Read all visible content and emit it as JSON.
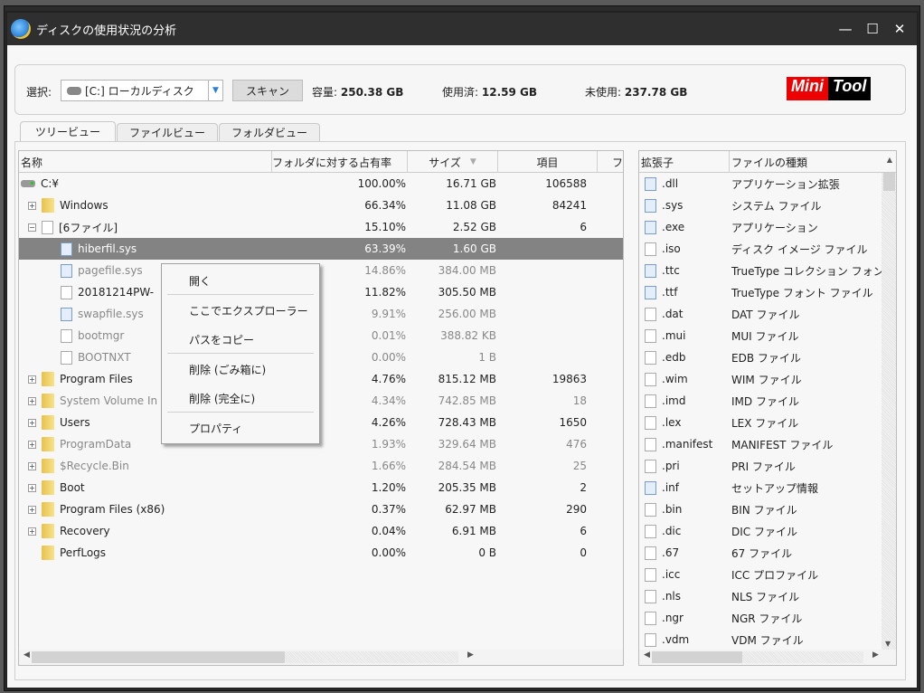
{
  "window": {
    "title": "ディスクの使用状況の分析",
    "minimize": "—",
    "maximize": "☐",
    "close": "✕"
  },
  "toolbar": {
    "select_label": "選択:",
    "drive_value": "[C:] ローカルディスク",
    "scan_label": "スキャン",
    "capacity_label": "容量:",
    "capacity_value": "250.38 GB",
    "used_label": "使用済:",
    "used_value": "12.59 GB",
    "free_label": "未使用:",
    "free_value": "237.78 GB",
    "logo_mini": "Mini",
    "logo_tool": "Tool"
  },
  "tabs": [
    {
      "label": "ツリービュー",
      "active": true
    },
    {
      "label": "ファイルビュー"
    },
    {
      "label": "フォルダビュー"
    }
  ],
  "tree": {
    "headers": {
      "name": "名称",
      "percent": "フォルダに対する占有率",
      "size": "サイズ",
      "items": "項目",
      "more": "フ"
    },
    "rows": [
      {
        "name": "C:¥",
        "percent": "100.00%",
        "size": "16.71 GB",
        "items": "106588",
        "icon": "drive",
        "level": 0,
        "exp": ""
      },
      {
        "name": "Windows",
        "percent": "66.34%",
        "size": "11.08 GB",
        "items": "84241",
        "icon": "folder",
        "level": 1,
        "exp": "+"
      },
      {
        "name": "[6ファイル]",
        "percent": "15.10%",
        "size": "2.52 GB",
        "items": "6",
        "icon": "file",
        "level": 1,
        "exp": "−"
      },
      {
        "name": "hiberfil.sys",
        "percent": "63.39%",
        "size": "1.60 GB",
        "items": "",
        "icon": "sys",
        "level": 2,
        "exp": "",
        "selected": true
      },
      {
        "name": "pagefile.sys",
        "percent": "14.86%",
        "size": "384.00 MB",
        "items": "",
        "icon": "sys",
        "level": 2,
        "exp": "",
        "gray": true
      },
      {
        "name": "20181214PW-",
        "percent": "11.82%",
        "size": "305.50 MB",
        "items": "",
        "icon": "iso",
        "level": 2,
        "exp": ""
      },
      {
        "name": "swapfile.sys",
        "percent": "9.91%",
        "size": "256.00 MB",
        "items": "",
        "icon": "sys",
        "level": 2,
        "exp": "",
        "gray": true
      },
      {
        "name": "bootmgr",
        "percent": "0.01%",
        "size": "388.82 KB",
        "items": "",
        "icon": "file",
        "level": 2,
        "exp": "",
        "gray": true
      },
      {
        "name": "BOOTNXT",
        "percent": "0.00%",
        "size": "1 B",
        "items": "",
        "icon": "file",
        "level": 2,
        "exp": "",
        "gray": true
      },
      {
        "name": "Program Files",
        "percent": "4.76%",
        "size": "815.12 MB",
        "items": "19863",
        "icon": "folder",
        "level": 1,
        "exp": "+"
      },
      {
        "name": "System Volume In",
        "percent": "4.34%",
        "size": "742.85 MB",
        "items": "18",
        "icon": "folder",
        "level": 1,
        "exp": "+",
        "gray": true
      },
      {
        "name": "Users",
        "percent": "4.26%",
        "size": "728.43 MB",
        "items": "1650",
        "icon": "folder",
        "level": 1,
        "exp": "+"
      },
      {
        "name": "ProgramData",
        "percent": "1.93%",
        "size": "329.64 MB",
        "items": "476",
        "icon": "folder",
        "level": 1,
        "exp": "+",
        "gray": true
      },
      {
        "name": "$Recycle.Bin",
        "percent": "1.66%",
        "size": "284.54 MB",
        "items": "25",
        "icon": "folder",
        "level": 1,
        "exp": "+",
        "gray": true
      },
      {
        "name": "Boot",
        "percent": "1.20%",
        "size": "205.35 MB",
        "items": "2",
        "icon": "folder",
        "level": 1,
        "exp": "+"
      },
      {
        "name": "Program Files (x86)",
        "percent": "0.37%",
        "size": "62.97 MB",
        "items": "290",
        "icon": "folder",
        "level": 1,
        "exp": "+"
      },
      {
        "name": "Recovery",
        "percent": "0.04%",
        "size": "6.91 MB",
        "items": "6",
        "icon": "folder",
        "level": 1,
        "exp": "+"
      },
      {
        "name": "PerfLogs",
        "percent": "0.00%",
        "size": "0 B",
        "items": "0",
        "icon": "folder",
        "level": 1,
        "exp": ""
      }
    ]
  },
  "context_menu": {
    "items": [
      "開く",
      "ここでエクスプローラー",
      "パスをコピー",
      "削除 (ごみ箱に)",
      "削除 (完全に)",
      "プロパティ"
    ]
  },
  "extensions": {
    "headers": {
      "ext": "拡張子",
      "type": "ファイルの種類"
    },
    "rows": [
      {
        "ext": ".dll",
        "type": "アプリケーション拡張",
        "icon": "sys"
      },
      {
        "ext": ".sys",
        "type": "システム ファイル",
        "icon": "sys"
      },
      {
        "ext": ".exe",
        "type": "アプリケーション",
        "icon": "exe"
      },
      {
        "ext": ".iso",
        "type": "ディスク イメージ ファイル",
        "icon": "iso"
      },
      {
        "ext": ".ttc",
        "type": "TrueType コレクション フォント フ",
        "icon": "font"
      },
      {
        "ext": ".ttf",
        "type": "TrueType フォント ファイル",
        "icon": "font"
      },
      {
        "ext": ".dat",
        "type": "DAT ファイル",
        "icon": "file"
      },
      {
        "ext": ".mui",
        "type": "MUI ファイル",
        "icon": "file"
      },
      {
        "ext": ".edb",
        "type": "EDB ファイル",
        "icon": "file"
      },
      {
        "ext": ".wim",
        "type": "WIM ファイル",
        "icon": "file"
      },
      {
        "ext": ".imd",
        "type": "IMD ファイル",
        "icon": "file"
      },
      {
        "ext": ".lex",
        "type": "LEX ファイル",
        "icon": "file"
      },
      {
        "ext": ".manifest",
        "type": "MANIFEST ファイル",
        "icon": "file"
      },
      {
        "ext": ".pri",
        "type": "PRI ファイル",
        "icon": "file"
      },
      {
        "ext": ".inf",
        "type": "セットアップ情報",
        "icon": "inf"
      },
      {
        "ext": ".bin",
        "type": "BIN ファイル",
        "icon": "file"
      },
      {
        "ext": ".dic",
        "type": "DIC ファイル",
        "icon": "file"
      },
      {
        "ext": ".67",
        "type": "67 ファイル",
        "icon": "file"
      },
      {
        "ext": ".icc",
        "type": "ICC プロファイル",
        "icon": "icc"
      },
      {
        "ext": ".nls",
        "type": "NLS ファイル",
        "icon": "file"
      },
      {
        "ext": ".ngr",
        "type": "NGR ファイル",
        "icon": "file"
      },
      {
        "ext": ".vdm",
        "type": "VDM ファイル",
        "icon": "file"
      }
    ]
  }
}
